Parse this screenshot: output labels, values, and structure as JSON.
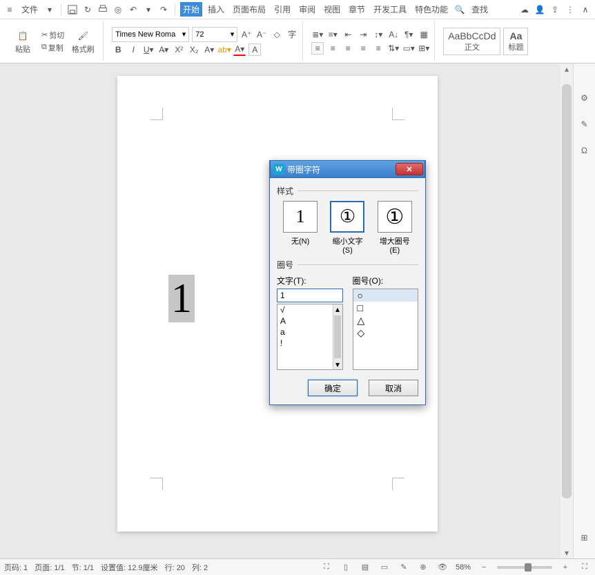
{
  "menubar": {
    "file": "文件",
    "tabs": [
      "开始",
      "插入",
      "页面布局",
      "引用",
      "审阅",
      "视图",
      "章节",
      "开发工具",
      "特色功能"
    ],
    "active_tab_index": 0,
    "search": "查找"
  },
  "ribbon": {
    "paste_label": "粘贴",
    "cut_label": "剪切",
    "copy_label": "复制",
    "format_painter_label": "格式刷",
    "font_name": "Times New Roma",
    "font_size": "72",
    "style_normal_preview": "AaBbCcDd",
    "style_normal_label": "正文",
    "style_heading_preview": "Aa",
    "style_heading_label": "标题"
  },
  "document": {
    "selected_text": "1"
  },
  "dialog": {
    "title": "带圈字符",
    "section_style": "样式",
    "opts": [
      {
        "label": "无(N)",
        "preview": "1"
      },
      {
        "label": "缩小文字(S)",
        "preview": "①"
      },
      {
        "label": "增大圈号(E)",
        "preview": "①"
      }
    ],
    "selected_style_index": 1,
    "section_frame": "圈号",
    "text_label": "文字(T):",
    "frame_label": "圈号(O):",
    "text_value": "1",
    "text_options": [
      "√",
      "A",
      "a",
      "!"
    ],
    "shape_options": [
      "○",
      "□",
      "△",
      "◇"
    ],
    "selected_shape_index": 0,
    "ok": "确定",
    "cancel": "取消"
  },
  "statusbar": {
    "page_num": "页码: 1",
    "page_total": "页面: 1/1",
    "section": "节: 1/1",
    "indent": "设置值: 12.9厘米",
    "row": "行: 20",
    "col": "列: 2",
    "zoom": "58%"
  }
}
